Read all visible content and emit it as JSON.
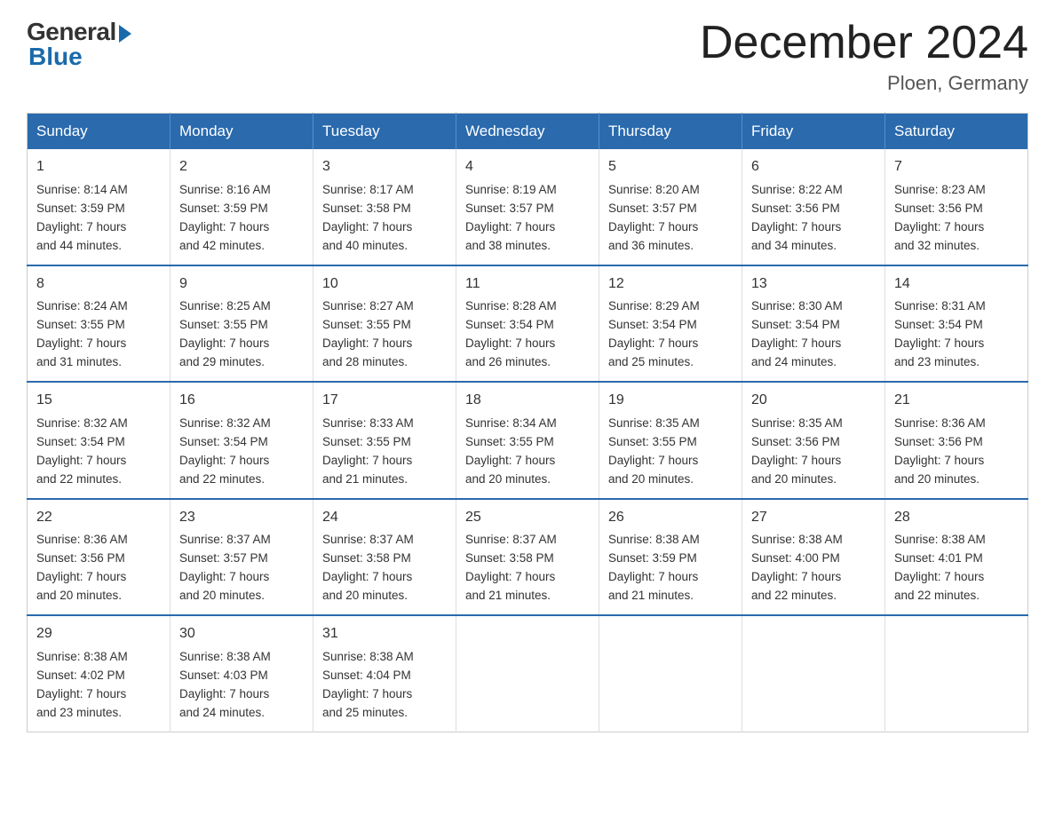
{
  "logo": {
    "general": "General",
    "blue": "Blue"
  },
  "title": "December 2024",
  "location": "Ploen, Germany",
  "days_of_week": [
    "Sunday",
    "Monday",
    "Tuesday",
    "Wednesday",
    "Thursday",
    "Friday",
    "Saturday"
  ],
  "weeks": [
    [
      {
        "day": "1",
        "sunrise": "Sunrise: 8:14 AM",
        "sunset": "Sunset: 3:59 PM",
        "daylight": "Daylight: 7 hours",
        "minutes": "and 44 minutes."
      },
      {
        "day": "2",
        "sunrise": "Sunrise: 8:16 AM",
        "sunset": "Sunset: 3:59 PM",
        "daylight": "Daylight: 7 hours",
        "minutes": "and 42 minutes."
      },
      {
        "day": "3",
        "sunrise": "Sunrise: 8:17 AM",
        "sunset": "Sunset: 3:58 PM",
        "daylight": "Daylight: 7 hours",
        "minutes": "and 40 minutes."
      },
      {
        "day": "4",
        "sunrise": "Sunrise: 8:19 AM",
        "sunset": "Sunset: 3:57 PM",
        "daylight": "Daylight: 7 hours",
        "minutes": "and 38 minutes."
      },
      {
        "day": "5",
        "sunrise": "Sunrise: 8:20 AM",
        "sunset": "Sunset: 3:57 PM",
        "daylight": "Daylight: 7 hours",
        "minutes": "and 36 minutes."
      },
      {
        "day": "6",
        "sunrise": "Sunrise: 8:22 AM",
        "sunset": "Sunset: 3:56 PM",
        "daylight": "Daylight: 7 hours",
        "minutes": "and 34 minutes."
      },
      {
        "day": "7",
        "sunrise": "Sunrise: 8:23 AM",
        "sunset": "Sunset: 3:56 PM",
        "daylight": "Daylight: 7 hours",
        "minutes": "and 32 minutes."
      }
    ],
    [
      {
        "day": "8",
        "sunrise": "Sunrise: 8:24 AM",
        "sunset": "Sunset: 3:55 PM",
        "daylight": "Daylight: 7 hours",
        "minutes": "and 31 minutes."
      },
      {
        "day": "9",
        "sunrise": "Sunrise: 8:25 AM",
        "sunset": "Sunset: 3:55 PM",
        "daylight": "Daylight: 7 hours",
        "minutes": "and 29 minutes."
      },
      {
        "day": "10",
        "sunrise": "Sunrise: 8:27 AM",
        "sunset": "Sunset: 3:55 PM",
        "daylight": "Daylight: 7 hours",
        "minutes": "and 28 minutes."
      },
      {
        "day": "11",
        "sunrise": "Sunrise: 8:28 AM",
        "sunset": "Sunset: 3:54 PM",
        "daylight": "Daylight: 7 hours",
        "minutes": "and 26 minutes."
      },
      {
        "day": "12",
        "sunrise": "Sunrise: 8:29 AM",
        "sunset": "Sunset: 3:54 PM",
        "daylight": "Daylight: 7 hours",
        "minutes": "and 25 minutes."
      },
      {
        "day": "13",
        "sunrise": "Sunrise: 8:30 AM",
        "sunset": "Sunset: 3:54 PM",
        "daylight": "Daylight: 7 hours",
        "minutes": "and 24 minutes."
      },
      {
        "day": "14",
        "sunrise": "Sunrise: 8:31 AM",
        "sunset": "Sunset: 3:54 PM",
        "daylight": "Daylight: 7 hours",
        "minutes": "and 23 minutes."
      }
    ],
    [
      {
        "day": "15",
        "sunrise": "Sunrise: 8:32 AM",
        "sunset": "Sunset: 3:54 PM",
        "daylight": "Daylight: 7 hours",
        "minutes": "and 22 minutes."
      },
      {
        "day": "16",
        "sunrise": "Sunrise: 8:32 AM",
        "sunset": "Sunset: 3:54 PM",
        "daylight": "Daylight: 7 hours",
        "minutes": "and 22 minutes."
      },
      {
        "day": "17",
        "sunrise": "Sunrise: 8:33 AM",
        "sunset": "Sunset: 3:55 PM",
        "daylight": "Daylight: 7 hours",
        "minutes": "and 21 minutes."
      },
      {
        "day": "18",
        "sunrise": "Sunrise: 8:34 AM",
        "sunset": "Sunset: 3:55 PM",
        "daylight": "Daylight: 7 hours",
        "minutes": "and 20 minutes."
      },
      {
        "day": "19",
        "sunrise": "Sunrise: 8:35 AM",
        "sunset": "Sunset: 3:55 PM",
        "daylight": "Daylight: 7 hours",
        "minutes": "and 20 minutes."
      },
      {
        "day": "20",
        "sunrise": "Sunrise: 8:35 AM",
        "sunset": "Sunset: 3:56 PM",
        "daylight": "Daylight: 7 hours",
        "minutes": "and 20 minutes."
      },
      {
        "day": "21",
        "sunrise": "Sunrise: 8:36 AM",
        "sunset": "Sunset: 3:56 PM",
        "daylight": "Daylight: 7 hours",
        "minutes": "and 20 minutes."
      }
    ],
    [
      {
        "day": "22",
        "sunrise": "Sunrise: 8:36 AM",
        "sunset": "Sunset: 3:56 PM",
        "daylight": "Daylight: 7 hours",
        "minutes": "and 20 minutes."
      },
      {
        "day": "23",
        "sunrise": "Sunrise: 8:37 AM",
        "sunset": "Sunset: 3:57 PM",
        "daylight": "Daylight: 7 hours",
        "minutes": "and 20 minutes."
      },
      {
        "day": "24",
        "sunrise": "Sunrise: 8:37 AM",
        "sunset": "Sunset: 3:58 PM",
        "daylight": "Daylight: 7 hours",
        "minutes": "and 20 minutes."
      },
      {
        "day": "25",
        "sunrise": "Sunrise: 8:37 AM",
        "sunset": "Sunset: 3:58 PM",
        "daylight": "Daylight: 7 hours",
        "minutes": "and 21 minutes."
      },
      {
        "day": "26",
        "sunrise": "Sunrise: 8:38 AM",
        "sunset": "Sunset: 3:59 PM",
        "daylight": "Daylight: 7 hours",
        "minutes": "and 21 minutes."
      },
      {
        "day": "27",
        "sunrise": "Sunrise: 8:38 AM",
        "sunset": "Sunset: 4:00 PM",
        "daylight": "Daylight: 7 hours",
        "minutes": "and 22 minutes."
      },
      {
        "day": "28",
        "sunrise": "Sunrise: 8:38 AM",
        "sunset": "Sunset: 4:01 PM",
        "daylight": "Daylight: 7 hours",
        "minutes": "and 22 minutes."
      }
    ],
    [
      {
        "day": "29",
        "sunrise": "Sunrise: 8:38 AM",
        "sunset": "Sunset: 4:02 PM",
        "daylight": "Daylight: 7 hours",
        "minutes": "and 23 minutes."
      },
      {
        "day": "30",
        "sunrise": "Sunrise: 8:38 AM",
        "sunset": "Sunset: 4:03 PM",
        "daylight": "Daylight: 7 hours",
        "minutes": "and 24 minutes."
      },
      {
        "day": "31",
        "sunrise": "Sunrise: 8:38 AM",
        "sunset": "Sunset: 4:04 PM",
        "daylight": "Daylight: 7 hours",
        "minutes": "and 25 minutes."
      },
      null,
      null,
      null,
      null
    ]
  ]
}
